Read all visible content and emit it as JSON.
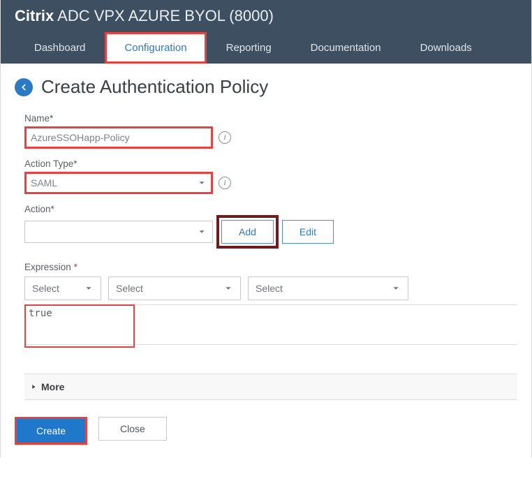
{
  "header": {
    "brand_bold": "Citrix",
    "brand_rest": " ADC VPX AZURE BYOL (8000)",
    "tabs": {
      "dashboard": "Dashboard",
      "configuration": "Configuration",
      "reporting": "Reporting",
      "documentation": "Documentation",
      "downloads": "Downloads"
    }
  },
  "page": {
    "title": "Create Authentication Policy"
  },
  "form": {
    "name": {
      "label": "Name*",
      "value": "AzureSSOHapp-Policy"
    },
    "action_type": {
      "label": "Action Type*",
      "value": "SAML"
    },
    "action": {
      "label": "Action*",
      "value": "",
      "add": "Add",
      "edit": "Edit"
    },
    "expression": {
      "label": "Expression",
      "select1": "Select",
      "select2": "Select",
      "select3": "Select",
      "text": "true"
    },
    "more": "More"
  },
  "footer": {
    "create": "Create",
    "close": "Close"
  }
}
